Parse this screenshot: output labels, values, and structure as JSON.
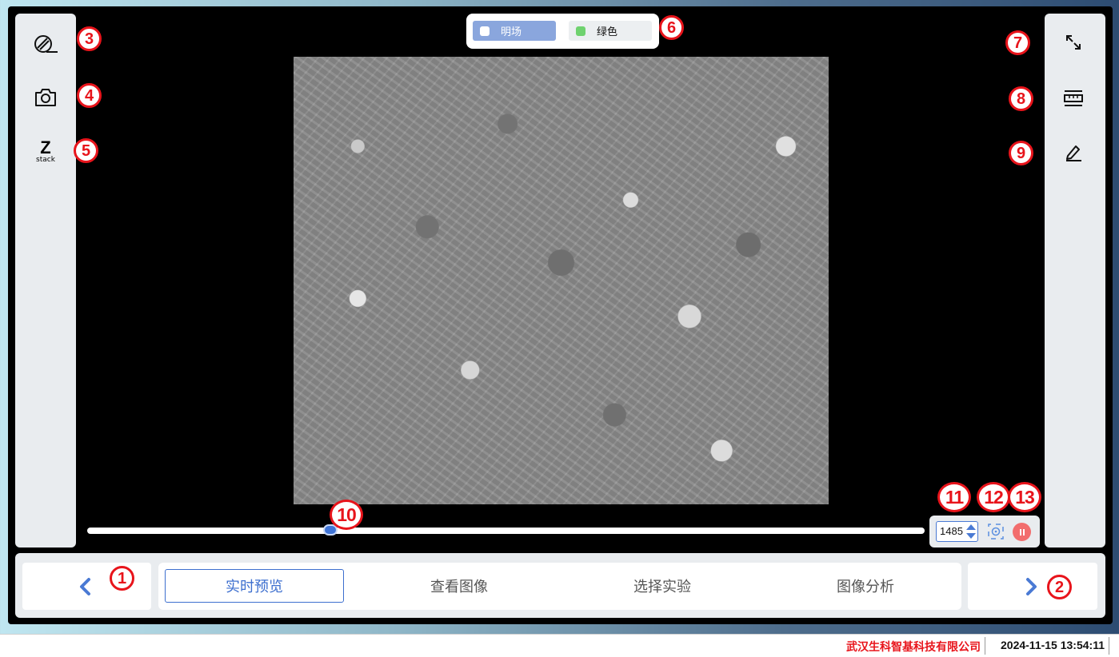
{
  "channels": [
    {
      "label": "明场",
      "dot_color": "#ffffff"
    },
    {
      "label": "绿色",
      "dot_color": "#6fd26f"
    }
  ],
  "focus": {
    "value": "1485",
    "slider_fraction": 0.29
  },
  "left_tools": [
    {
      "icon": "objective-icon"
    },
    {
      "icon": "camera-icon"
    },
    {
      "icon": "z-stack-icon",
      "letter": "Z",
      "label": "stack"
    }
  ],
  "right_tools": [
    {
      "icon": "fullscreen-icon"
    },
    {
      "icon": "ruler-icon"
    },
    {
      "icon": "pencil-icon"
    }
  ],
  "tabs": [
    {
      "label": "实时预览",
      "active": true
    },
    {
      "label": "查看图像",
      "active": false
    },
    {
      "label": "选择实验",
      "active": false
    },
    {
      "label": "图像分析",
      "active": false
    }
  ],
  "annotations": [
    "1",
    "2",
    "3",
    "4",
    "5",
    "6",
    "7",
    "8",
    "9",
    "10",
    "11",
    "12",
    "13"
  ],
  "status": {
    "company": "武汉生科智基科技有限公司",
    "datetime": "2024-11-15 13:54:11"
  },
  "colors": {
    "accent": "#3d6fcf",
    "annotation": "#e8141b",
    "pause": "#f26d6d"
  }
}
